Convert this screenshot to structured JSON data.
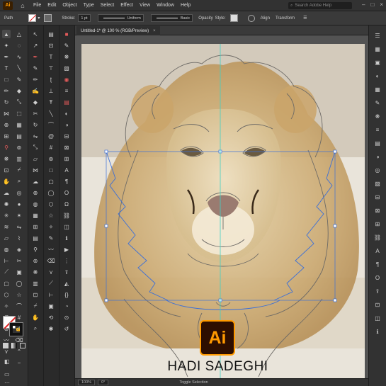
{
  "menubar": {
    "app_logo": "Ai",
    "items": [
      "File",
      "Edit",
      "Object",
      "Type",
      "Select",
      "Effect",
      "View",
      "Window",
      "Help"
    ],
    "search_placeholder": "Search Adobe Help"
  },
  "controlbar": {
    "selection": "Path",
    "stroke_label": "Stroke:",
    "stroke_value": "1 pt",
    "profile_label": "Uniform",
    "brush_label": "Basic",
    "opacity_label": "Opacity",
    "style_label": "Style:",
    "align_label": "Align",
    "transform_label": "Transform"
  },
  "document": {
    "tab_title": "Untitled-1* @ 100 % (RGB/Preview)",
    "close_glyph": "×"
  },
  "statusbar": {
    "zoom": "100%",
    "angle": "0°",
    "tool_status": "Toggle Selection"
  },
  "watermark": {
    "logo": "Ai",
    "name": "HADI SADEGHI"
  },
  "colors": {
    "accent": "#ff9a00",
    "selection": "#3b6fd8",
    "guide": "#3fd1c4"
  },
  "icons": {
    "tools": [
      "selection-tool-icon",
      "direct-selection-tool-icon",
      "magic-wand-tool-icon",
      "lasso-tool-icon",
      "pen-tool-icon",
      "curvature-tool-icon",
      "type-tool-icon",
      "line-tool-icon",
      "rectangle-tool-icon",
      "paintbrush-tool-icon",
      "pencil-tool-icon",
      "eraser-tool-icon",
      "rotate-tool-icon",
      "scale-tool-icon",
      "width-tool-icon",
      "free-transform-tool-icon",
      "shape-builder-tool-icon",
      "perspective-tool-icon",
      "mesh-tool-icon",
      "gradient-tool-icon",
      "eyedropper-tool-icon",
      "blend-tool-icon",
      "symbol-sprayer-tool-icon",
      "column-graph-tool-icon",
      "artboard-tool-icon",
      "slice-tool-icon",
      "hand-tool-icon",
      "zoom-tool-icon"
    ],
    "right_panel": [
      "properties-icon",
      "layers-icon",
      "libraries-icon",
      "color-icon",
      "swatches-icon",
      "brushes-icon",
      "symbols-icon",
      "stroke-icon",
      "gradient-icon",
      "transparency-icon",
      "appearance-icon",
      "graphic-styles-icon",
      "align-icon",
      "pathfinder-icon",
      "transform-icon",
      "links-icon"
    ]
  }
}
